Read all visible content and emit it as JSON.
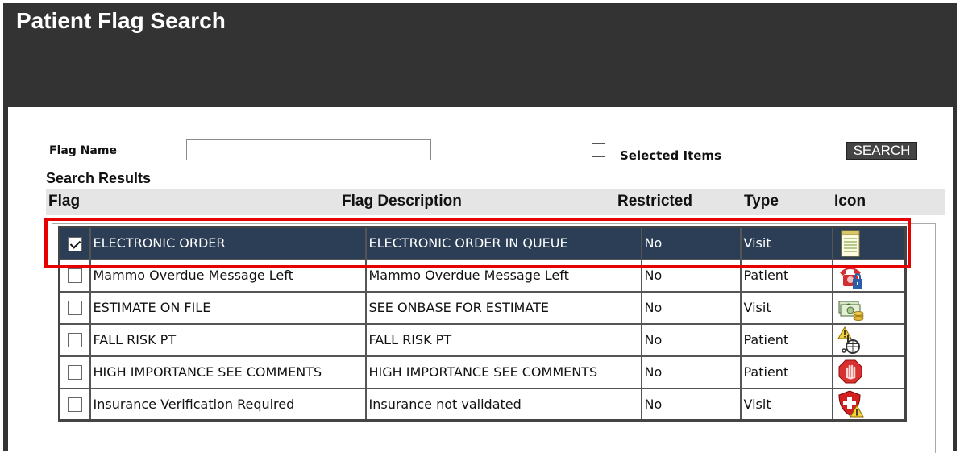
{
  "window": {
    "title": "Patient Flag Search"
  },
  "search": {
    "flag_name_label": "Flag Name",
    "flag_name_value": "",
    "selected_items_label": "Selected Items",
    "selected_items_checked": false,
    "search_button": "SEARCH"
  },
  "results": {
    "title": "Search Results",
    "columns": {
      "flag": "Flag",
      "description": "Flag Description",
      "restricted": "Restricted",
      "type": "Type",
      "icon": "Icon"
    },
    "rows": [
      {
        "checked": true,
        "selected": true,
        "flag": "ELECTRONIC ORDER",
        "description": "ELECTRONIC ORDER IN QUEUE",
        "restricted": "No",
        "type": "Visit",
        "icon": "notepad-icon"
      },
      {
        "checked": false,
        "selected": false,
        "flag": "Mammo Overdue Message Left",
        "description": "Mammo Overdue Message Left",
        "restricted": "No",
        "type": "Patient",
        "icon": "phone-lock-icon"
      },
      {
        "checked": false,
        "selected": false,
        "flag": "ESTIMATE ON FILE",
        "description": "SEE ONBASE FOR ESTIMATE",
        "restricted": "No",
        "type": "Visit",
        "icon": "money-coins-icon"
      },
      {
        "checked": false,
        "selected": false,
        "flag": "FALL RISK PT",
        "description": "FALL RISK PT",
        "restricted": "No",
        "type": "Patient",
        "icon": "wheelchair-warning-icon"
      },
      {
        "checked": false,
        "selected": false,
        "flag": "HIGH IMPORTANCE SEE COMMENTS",
        "description": "HIGH IMPORTANCE SEE COMMENTS",
        "restricted": "No",
        "type": "Patient",
        "icon": "stop-hand-icon"
      },
      {
        "checked": false,
        "selected": false,
        "flag": "Insurance Verification Required",
        "description": "Insurance not validated",
        "restricted": "No",
        "type": "Visit",
        "icon": "shield-warning-icon"
      }
    ]
  },
  "colors": {
    "header_bg": "#333333",
    "selected_row_bg": "#2c3e55",
    "highlight_border": "#e60000"
  }
}
